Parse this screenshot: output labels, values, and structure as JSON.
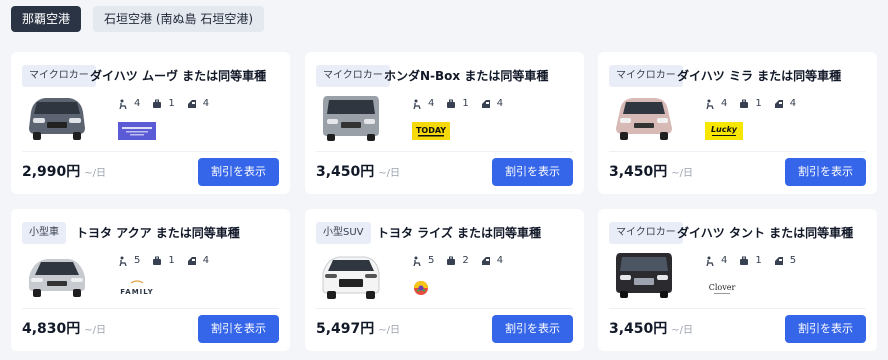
{
  "tabs": [
    {
      "label": "那覇空港"
    },
    {
      "label": "石垣空港 (南ぬ島 石垣空港)"
    }
  ],
  "colors": {
    "accent": "#3565e8",
    "tab_active": "#2b3444"
  },
  "spec_icons": [
    "seat-icon",
    "bag-icon",
    "door-icon"
  ],
  "cars": [
    {
      "category": "マイクロカー",
      "name": "ダイハツ ムーヴ または同等車種",
      "seats": "4",
      "bags": "1",
      "doors": "4",
      "logo": "Nippon Rent-A-Car",
      "price": "2,990円",
      "per": "~/日",
      "button": "割引を表示",
      "car_color": "#5b6470"
    },
    {
      "category": "マイクロカー",
      "name": "ホンダN-Box または同等車種",
      "seats": "4",
      "bags": "1",
      "doors": "4",
      "logo": "TODAY",
      "price": "3,450円",
      "per": "~/日",
      "button": "割引を表示",
      "car_color": "#9aa0a8"
    },
    {
      "category": "マイクロカー",
      "name": "ダイハツ ミラ または同等車種",
      "seats": "4",
      "bags": "1",
      "doors": "4",
      "logo": "Lucky",
      "price": "3,450円",
      "per": "~/日",
      "button": "割引を表示",
      "car_color": "#d7b9b5"
    },
    {
      "category": "小型車",
      "name": "トヨタ アクア または同等車種",
      "seats": "5",
      "bags": "1",
      "doors": "4",
      "logo": "FAMILY",
      "price": "4,830円",
      "per": "~/日",
      "button": "割引を表示",
      "car_color": "#c7cbd0"
    },
    {
      "category": "小型SUV",
      "name": "トヨタ ライズ または同等車種",
      "seats": "5",
      "bags": "2",
      "doors": "4",
      "logo": "rainbow",
      "price": "5,497円",
      "per": "~/日",
      "button": "割引を表示",
      "car_color": "#f4f4f4"
    },
    {
      "category": "マイクロカー",
      "name": "ダイハツ タント または同等車種",
      "seats": "4",
      "bags": "1",
      "doors": "5",
      "logo": "Clover",
      "price": "3,450円",
      "per": "~/日",
      "button": "割引を表示",
      "car_color": "#2b2b2f"
    }
  ]
}
